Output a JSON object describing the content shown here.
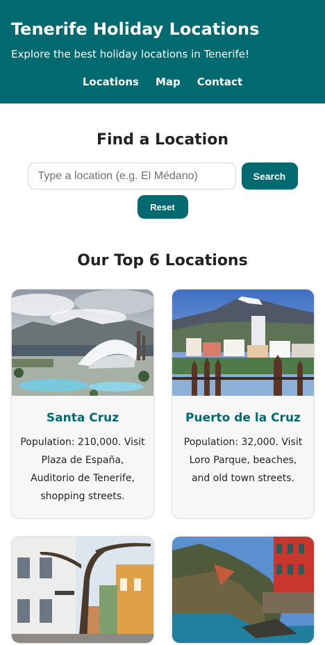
{
  "header": {
    "title": "Tenerife Holiday Locations",
    "subtitle": "Explore the best holiday locations in Tenerife!",
    "nav": [
      {
        "label": "Locations"
      },
      {
        "label": "Map"
      },
      {
        "label": "Contact"
      }
    ]
  },
  "search": {
    "heading": "Find a Location",
    "placeholder": "Type a location (e.g. El Médano)",
    "value": "",
    "search_label": "Search",
    "reset_label": "Reset"
  },
  "top": {
    "heading": "Our Top 6 Locations",
    "cards": [
      {
        "title": "Santa Cruz",
        "description": "Population: 210,000. Visit Plaza de España, Auditorio de Tenerife, shopping streets."
      },
      {
        "title": "Puerto de la Cruz",
        "description": "Population: 32,000. Visit Loro Parque, beaches, and old town streets."
      }
    ]
  },
  "colors": {
    "brand": "#006a70",
    "card_bg": "#f7f7f7"
  }
}
